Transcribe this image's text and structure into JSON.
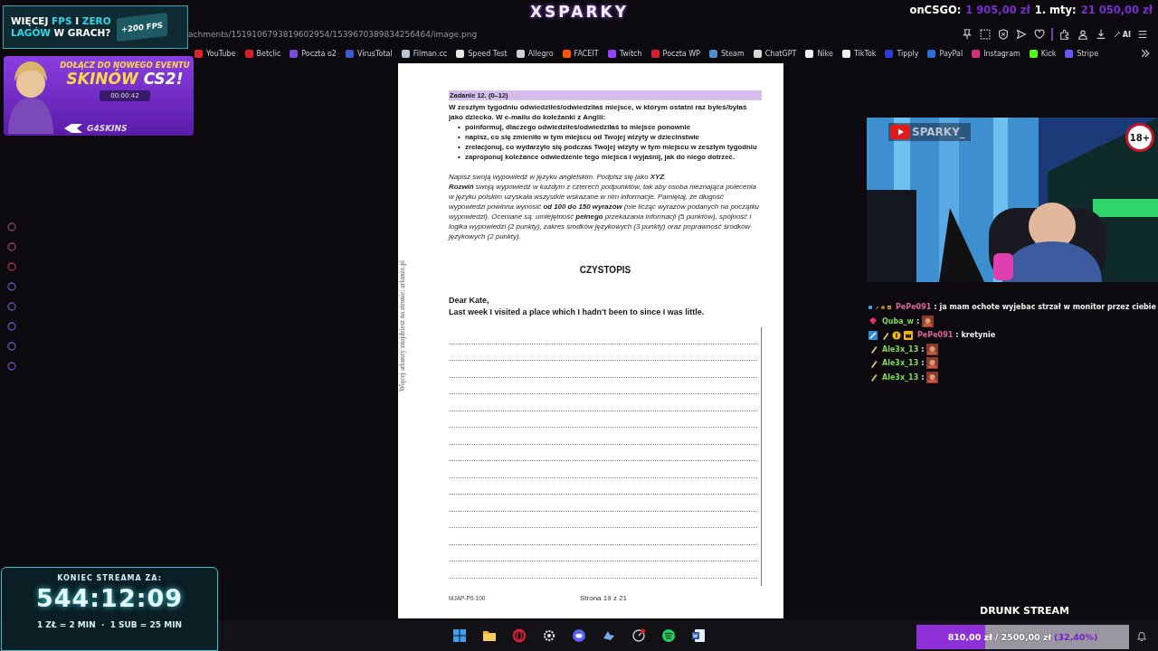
{
  "browser": {
    "address": "achments/1519106793819602954/1539670389834256464/image.png",
    "toolbar_text": "AI",
    "bookmarks": [
      {
        "label": "YouTube",
        "color": "#e0242b"
      },
      {
        "label": "Betclic",
        "color": "#d81e2a"
      },
      {
        "label": "Poczta o2",
        "color": "#7b4be0"
      },
      {
        "label": "VirusTotal",
        "color": "#3a5bd8"
      },
      {
        "label": "Filman.cc",
        "color": "#b8c4d6"
      },
      {
        "label": "Speed Test",
        "color": "#e8e8e8"
      },
      {
        "label": "Allegro",
        "color": "#cfcfcf"
      },
      {
        "label": "FACEIT",
        "color": "#ff5500"
      },
      {
        "label": "Twitch",
        "color": "#9146ff"
      },
      {
        "label": "Poczta WP",
        "color": "#d61f2c"
      },
      {
        "label": "Steam",
        "color": "#4f8fc7"
      },
      {
        "label": "ChatGPT",
        "color": "#d9d9d9"
      },
      {
        "label": "Nike",
        "color": "#f2f2f2"
      },
      {
        "label": "TikTok",
        "color": "#eeeeee"
      },
      {
        "label": "Tipply",
        "color": "#2b3fd8"
      },
      {
        "label": "PayPal",
        "color": "#2a6fd6"
      },
      {
        "label": "Instagram",
        "color": "#d6307a"
      },
      {
        "label": "Kick",
        "color": "#53fc18"
      },
      {
        "label": "Stripe",
        "color": "#635bff"
      }
    ]
  },
  "document": {
    "task_heading": "Zadanie 12. (0–12)",
    "intro": "W zeszłym tygodniu odwiedziłeś/odwiedziłaś miejsce, w którym ostatni raz byłeś/byłaś jako dziecko. W e-mailu do koleżanki z Anglii:",
    "bullets": [
      {
        "marker": "•",
        "text": "poinformuj, dlaczego odwiedziłeś/odwiedziłaś to miejsce ponownie"
      },
      {
        "marker": "•",
        "text": "napisz, co się zmieniło w tym miejscu od Twojej wizyty w dzieciństwie"
      },
      {
        "marker": "•",
        "text": "zrelacjonuj, co wydarzyło się podczas Twojej wizyty w tym miejscu w zeszłym tygodniu"
      },
      {
        "marker": "•",
        "text": "zaproponuj koleżance odwiedzenie tego miejsca i wyjaśnij, jak do niego dotrzeć."
      }
    ],
    "instructions": [
      "Napisz swoją wypowiedź w języku angielskim. Podpisz się jako **XYZ**.",
      "**Rozwiń** swoją wypowiedź w każdym z czterech podpunktów, tak aby osoba nieznająca polecenia w języku polskim uzyskała wszystkie wskazane w nim informacje. Pamiętaj, że długość wypowiedzi powinna wynosić **od 100 do 150 wyrazów** (nie licząc wyrazów podanych na początku wypowiedzi). Oceniane są: umiejętność **pełnego** przekazania informacji (5 punktów), spójność i logika wypowiedzi (2 punkty), zakres środków językowych (3 punkty) oraz poprawność środków językowych (2 punkty)."
    ],
    "section_title": "CZYSTOPIS",
    "greeting": "Dear Kate,",
    "opening": "Last week I visited a place which I hadn't been to since I was little.",
    "side_note": "Więcej arkuszy znajdziesz na stronie: arkusze.pl",
    "code": "MJAP-P0-100",
    "page": "Strona 19 z 21"
  },
  "overlay": {
    "logo": "XSPARKY",
    "ad": {
      "line1_a": "WIĘCEJ ",
      "line1_b": "FPS",
      "line1_c": " I ",
      "line1_d": "ZERO",
      "line2_a": "LAGÓW",
      "line2_b": " W GRACH?",
      "badge": "+200 FPS"
    },
    "event": {
      "line1": "DOŁĄCZ DO NOWEGO EVENTU",
      "line2_a": "SKINÓW",
      "line2_b": " CS2!",
      "timer": "00:00:42",
      "brand": "G4SKINS"
    },
    "ticker": [
      {
        "label": "onCSGO:",
        "amount": "1 905,00 zł"
      },
      {
        "label": "1. mty:",
        "amount": "21 050,00 zł"
      }
    ],
    "webcam": {
      "channel": "SPARKY_",
      "age_badge": "18+"
    },
    "chat": [
      {
        "user": "PePe091",
        "color": "#d9679a",
        "badges": [
          {
            "kind": "tool"
          },
          {
            "kind": "pen"
          },
          {
            "kind": "coin"
          },
          {
            "kind": "crown"
          }
        ],
        "separator": ":",
        "kind": "text",
        "text": "ja mam ochote wyjebac strzał w monitor przez ciebie"
      },
      {
        "user": "Quba_w",
        "color": "#7fd85a",
        "badges": [
          {
            "kind": "gem"
          }
        ],
        "separator": ":",
        "kind": "emote"
      },
      {
        "user": "PePe091",
        "color": "#d9679a",
        "badges": [
          {
            "kind": "tool"
          },
          {
            "kind": "pen"
          },
          {
            "kind": "coin"
          },
          {
            "kind": "crown"
          }
        ],
        "separator": ":",
        "kind": "text",
        "text": "kretynie"
      },
      {
        "user": "Ale3x_13",
        "color": "#7fd85a",
        "badges": [
          {
            "kind": "pen"
          }
        ],
        "separator": ":",
        "kind": "emote"
      },
      {
        "user": "Ale3x_13",
        "color": "#7fd85a",
        "badges": [
          {
            "kind": "pen"
          }
        ],
        "separator": ":",
        "kind": "emote"
      },
      {
        "user": "Ale3x_13",
        "color": "#7fd85a",
        "badges": [
          {
            "kind": "pen"
          }
        ],
        "separator": ":",
        "kind": "emote"
      }
    ],
    "countdown": {
      "title": "KONIEC STREAMA ZA:",
      "time": "544:12:09",
      "rate": "1 ZŁ = 2 MIN  ·  1 SUB = 25 MIN"
    },
    "stream_title": "DRUNK STREAM",
    "goal": {
      "current": "810,00 zł",
      "target": "/ 2500,00 zł",
      "percent": "(32,40%)",
      "level": 0.324
    }
  }
}
